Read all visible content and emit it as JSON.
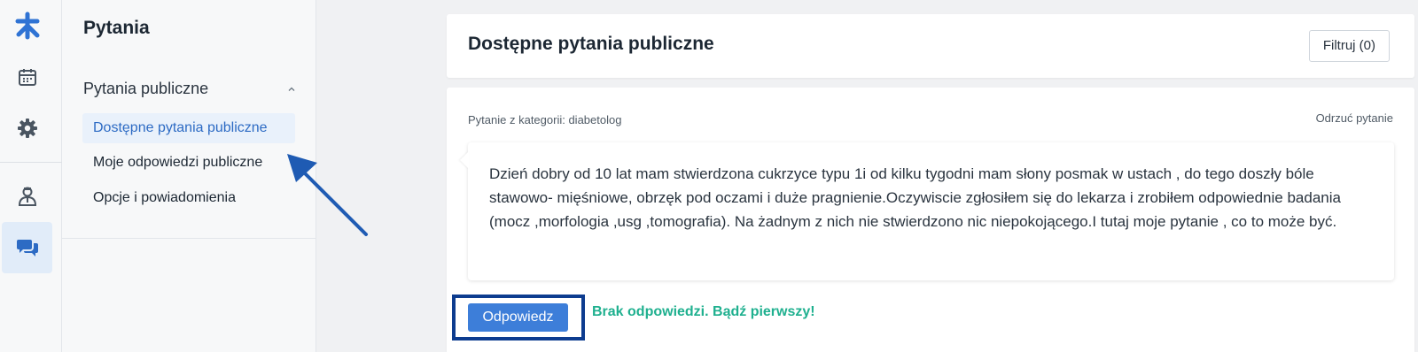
{
  "rail": {
    "items": [
      {
        "icon": "docplanner-logo-icon"
      },
      {
        "icon": "calendar-icon"
      },
      {
        "icon": "gear-icon"
      },
      {
        "icon": "doctor-icon"
      },
      {
        "icon": "chat-bubbles-icon",
        "active": true
      }
    ]
  },
  "sidebar": {
    "title": "Pytania",
    "group_label": "Pytania publiczne",
    "items": [
      {
        "label": "Dostępne pytania publiczne",
        "active": true
      },
      {
        "label": "Moje odpowiedzi publiczne"
      },
      {
        "label": "Opcje i powiadomienia"
      }
    ]
  },
  "header": {
    "title": "Dostępne pytania publiczne",
    "filter_label": "Filtruj (0)"
  },
  "question": {
    "category": "Pytanie z kategorii: diabetolog",
    "reject_label": "Odrzuć pytanie",
    "text": "Dzień dobry od 10 lat mam stwierdzona cukrzyce typu 1i od kilku tygodni mam słony posmak w ustach , do tego doszły bóle stawowo- mięśniowe, obrzęk pod oczami i duże pragnienie.Oczywiscie zgłosiłem się do lekarza i zrobiłem odpowiednie badania (mocz ,morfologia ,usg ,tomografia). Na żadnym z nich nie stwierdzono nic niepokojącego.I tutaj moje pytanie , co to może być.",
    "answer_label": "Odpowiedz",
    "no_answers_label": "Brak odpowiedzi. Bądź pierwszy!"
  },
  "colors": {
    "accent": "#3d7ed9",
    "active_text": "#2d6bc4",
    "success": "#1fb08f",
    "highlight_frame": "#0d3c8f",
    "rail_icon": "#4a5561"
  }
}
